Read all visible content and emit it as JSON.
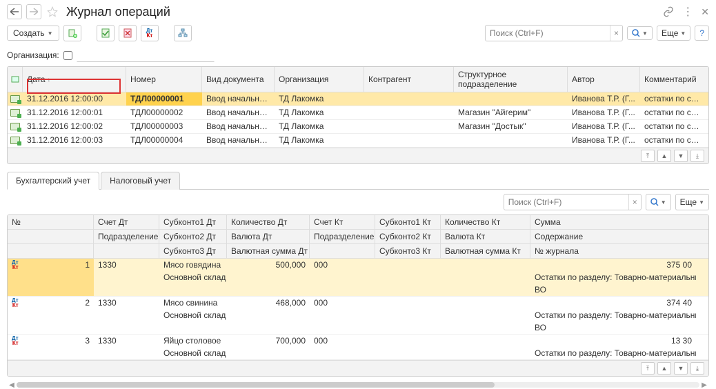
{
  "title": "Журнал операций",
  "toolbar": {
    "create_label": "Создать",
    "search_placeholder": "Поиск (Ctrl+F)",
    "more_label": "Еще",
    "help_label": "?"
  },
  "filter": {
    "org_label": "Организация:"
  },
  "grid": {
    "columns": [
      "Дата",
      "Номер",
      "Вид документа",
      "Организация",
      "Контрагент",
      "Структурное подразделение",
      "Автор",
      "Комментарий"
    ],
    "rows": [
      {
        "date": "31.12.2016 12:00:00",
        "num": "ТДЛ00000001",
        "doc": "Ввод начальных ...",
        "org": "ТД Лакомка",
        "contr": "",
        "struct": "",
        "auth": "Иванова Т.Р. (Г...",
        "comm": "остатки по сче..."
      },
      {
        "date": "31.12.2016 12:00:01",
        "num": "ТДЛ00000002",
        "doc": "Ввод начальных ...",
        "org": "ТД Лакомка",
        "contr": "",
        "struct": "Магазин \"Айгерим\"",
        "auth": "Иванова Т.Р. (Г...",
        "comm": "остатки по сче..."
      },
      {
        "date": "31.12.2016 12:00:02",
        "num": "ТДЛ00000003",
        "doc": "Ввод начальных ...",
        "org": "ТД Лакомка",
        "contr": "",
        "struct": "Магазин \"Достык\"",
        "auth": "Иванова Т.Р. (Г...",
        "comm": "остатки по сче..."
      },
      {
        "date": "31.12.2016 12:00:03",
        "num": "ТДЛ00000004",
        "doc": "Ввод начальных ...",
        "org": "ТД Лакомка",
        "contr": "",
        "struct": "",
        "auth": "Иванова Т.Р. (Г...",
        "comm": "остатки по сче..."
      }
    ]
  },
  "tabs": [
    "Бухгалтерский учет",
    "Налоговый учет"
  ],
  "detail_header": {
    "r1": [
      "№",
      "Счет Дт",
      "Субконто1 Дт",
      "Количество Дт",
      "Счет Кт",
      "Субконто1 Кт",
      "Количество Кт",
      "Сумма"
    ],
    "r2": [
      "",
      "Подразделение Дт",
      "Субконто2 Дт",
      "Валюта Дт",
      "Подразделение Кт",
      "Субконто2 Кт",
      "Валюта Кт",
      "Содержание"
    ],
    "r3": [
      "",
      "",
      "Субконто3 Дт",
      "Валютная сумма Дт",
      "",
      "Субконто3 Кт",
      "Валютная сумма Кт",
      "№ журнала"
    ]
  },
  "detail_rows": [
    {
      "n": "1",
      "sch": "1330",
      "sub": "Мясо говядина",
      "qty": "500,000",
      "sch2": "000",
      "sum": "375 00",
      "store": "Основной склад",
      "desc": "Остатки по разделу: Товарно-материальны",
      "jrn": "ВО"
    },
    {
      "n": "2",
      "sch": "1330",
      "sub": "Мясо свинина",
      "qty": "468,000",
      "sch2": "000",
      "sum": "374 40",
      "store": "Основной склад",
      "desc": "Остатки по разделу: Товарно-материальны",
      "jrn": "ВО"
    },
    {
      "n": "3",
      "sch": "1330",
      "sub": "Яйцо столовое",
      "qty": "700,000",
      "sch2": "000",
      "sum": "13 30",
      "store": "Основной склад",
      "desc": "Остатки по разделу: Товарно-материальны",
      "jrn": ""
    }
  ]
}
